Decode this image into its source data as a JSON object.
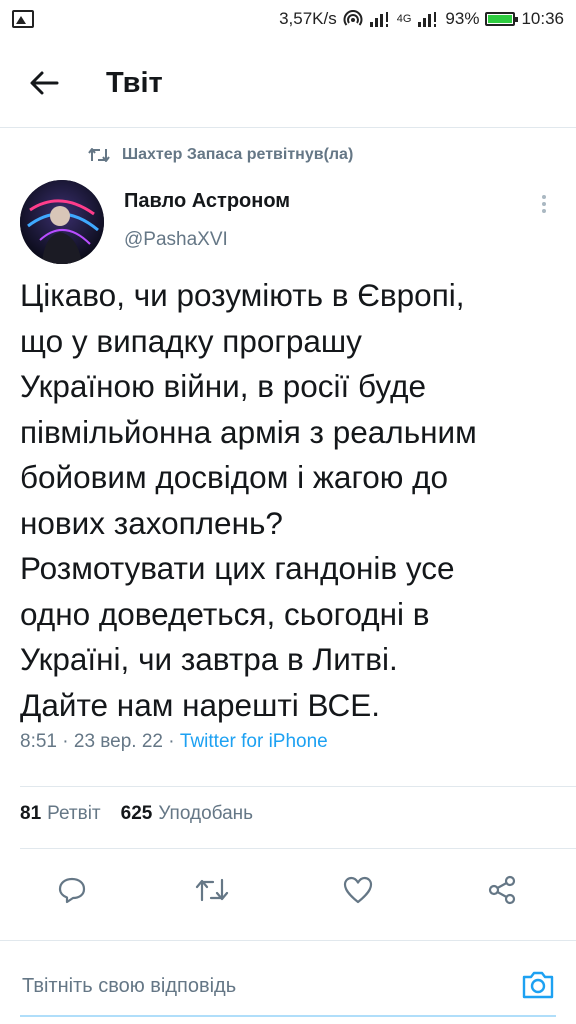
{
  "status_bar": {
    "speed": "3,57K/s",
    "network_type": "4G",
    "battery": "93%",
    "time": "10:36"
  },
  "header": {
    "title": "Твіт"
  },
  "retweet_context": {
    "label": "Шахтер Запаса ретвітнув(ла)"
  },
  "author": {
    "name": "Павло Астроном",
    "handle": "@PashaXVI"
  },
  "tweet": {
    "text": "Цікаво, чи розуміють в Європі,\nщо у випадку програшу\nУкраїною війни, в росії буде\nпівмільйонна армія з реальним\nбойовим досвідом і жагою до\nнових захоплень?\nРозмотувати цих гандонів усе\nодно доведеться, сьогодні в\nУкраїні, чи завтра в Литві.\nДайте нам нарешті ВСЕ.",
    "time": "8:51",
    "date": "23 вер. 22",
    "source": "Twitter for iPhone"
  },
  "stats": {
    "retweets_count": "81",
    "retweets_label": "Ретвіт",
    "likes_count": "625",
    "likes_label": "Уподобань"
  },
  "actions": [
    "reply-icon",
    "retweet-icon",
    "like-icon",
    "share-icon"
  ],
  "reply": {
    "placeholder": "Твітніть свою відповідь"
  },
  "colors": {
    "accent": "#1da1f2",
    "secondary_text": "#657786",
    "primary_text": "#14171a",
    "divider": "#e1e8ed"
  }
}
